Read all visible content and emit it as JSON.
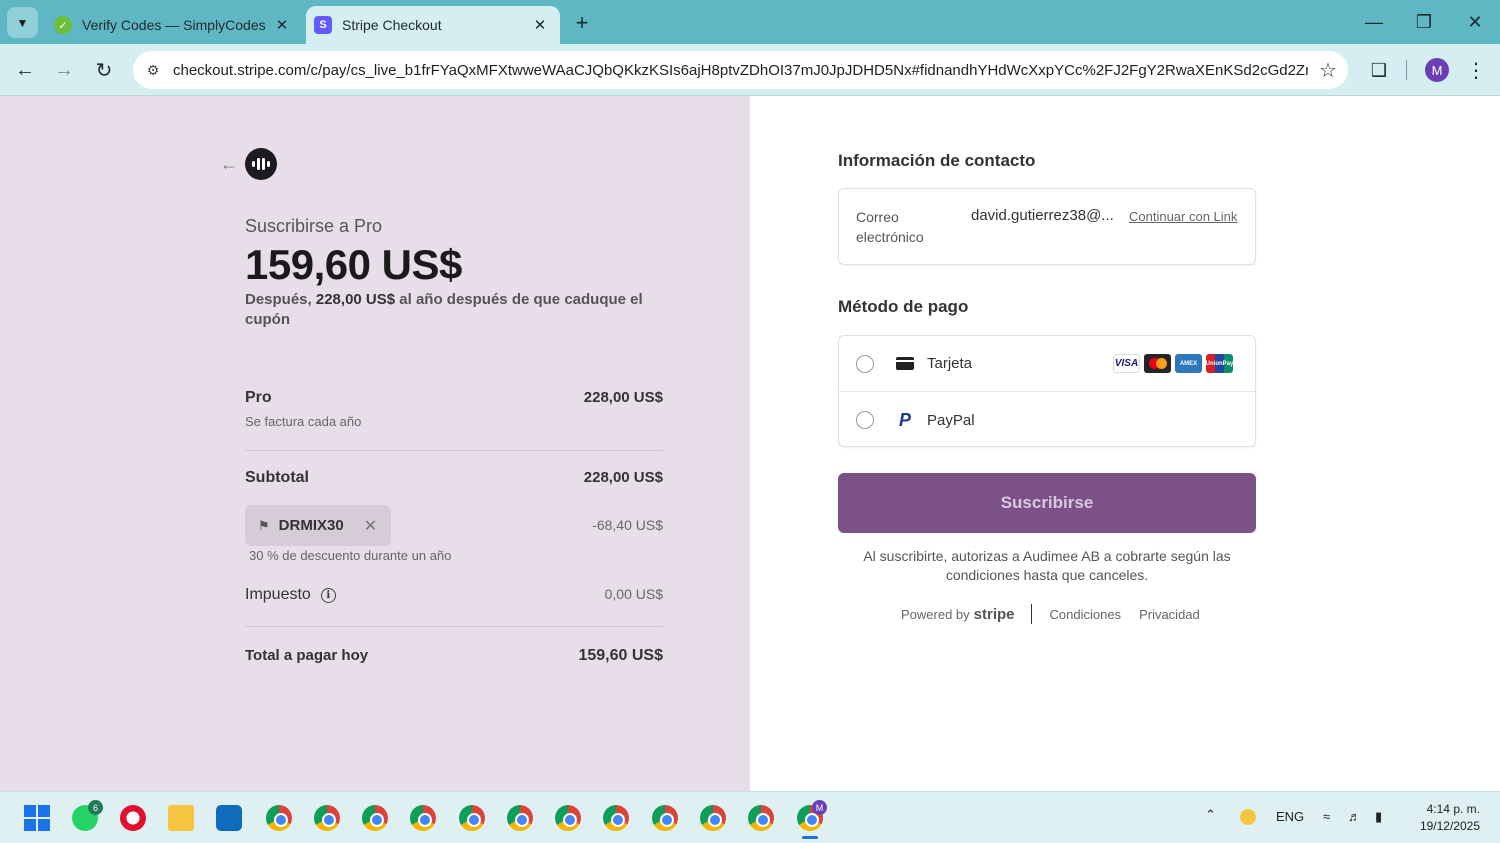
{
  "browser": {
    "tabs": [
      {
        "title": "Verify Codes — SimplyCodes",
        "active": false
      },
      {
        "title": "Stripe Checkout",
        "active": true
      }
    ],
    "url": "checkout.stripe.com/c/pay/cs_live_b1frFYaQxMFXtwweWAaCJQbQKkzKSIs6ajH8ptvZDhOI37mJ0JpJDHD5Nx#fidnandhYHdWcXxpYCc%2FJ2FgY2RwaXEnKSd2cGd2Zn...",
    "profile_initial": "M"
  },
  "summary": {
    "subscribe_to": "Suscribirse a Pro",
    "price": "159,60 US$",
    "after_prefix": "Después, ",
    "after_amount": "228,00 US$",
    "after_suffix": " al año después de que caduque el cupón",
    "item": {
      "name": "Pro",
      "price": "228,00 US$",
      "billing": "Se factura cada año"
    },
    "subtotal": {
      "label": "Subtotal",
      "value": "228,00 US$"
    },
    "coupon": {
      "code": "DRMIX30",
      "discount": "-68,40 US$",
      "description": "30 % de descuento durante un año"
    },
    "tax": {
      "label": "Impuesto",
      "value": "0,00 US$"
    },
    "total": {
      "label": "Total a pagar hoy",
      "value": "159,60 US$"
    }
  },
  "form": {
    "contact_title": "Información de contacto",
    "email_label": "Correo electrónico",
    "email_value": "david.gutierrez38@...",
    "link_label": "Continuar con Link",
    "payment_title": "Método de pago",
    "methods": [
      {
        "label": "Tarjeta",
        "icon": "card-icon"
      },
      {
        "label": "PayPal",
        "icon": "paypal-icon"
      }
    ],
    "brands": [
      "VISA",
      "AMEX",
      "UnionPay"
    ],
    "submit": "Suscribirse",
    "legal": "Al suscribirte, autorizas a Audimee AB a cobrarte según las condiciones hasta que canceles.",
    "powered_by": "Powered by",
    "stripe": "stripe",
    "terms": "Condiciones",
    "privacy": "Privacidad"
  },
  "taskbar": {
    "whatsapp_badge": "6",
    "language": "ENG",
    "time": "4:14 p. m.",
    "date": "19/12/2025"
  },
  "colors": {
    "accent": "#7b5188",
    "left_panel": "#e7dee9",
    "tabstrip": "#5fb7c3"
  }
}
